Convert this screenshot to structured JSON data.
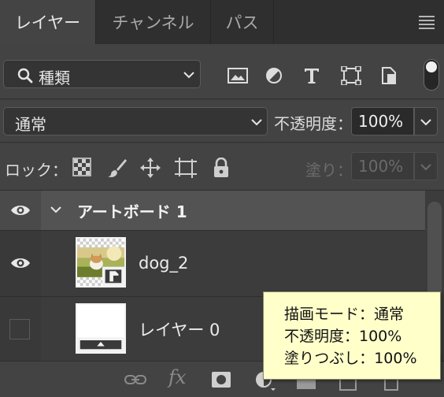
{
  "tabs": [
    {
      "label": "レイヤー",
      "active": true
    },
    {
      "label": "チャンネル",
      "active": false
    },
    {
      "label": "パス",
      "active": false
    }
  ],
  "filter": {
    "kind_label": "種類",
    "icons": [
      "image-filter-icon",
      "adjustment-filter-icon",
      "type-filter-icon",
      "shape-filter-icon",
      "smart-object-filter-icon"
    ]
  },
  "blend": {
    "mode": "通常",
    "opacity_label": "不透明度：",
    "opacity_value": "100%"
  },
  "lock": {
    "label": "ロック：",
    "fill_label": "塗り：",
    "fill_value": "100%"
  },
  "layers": [
    {
      "name": "アートボード 1",
      "type": "artboard",
      "visible": true,
      "expanded": true
    },
    {
      "name": "dog_2",
      "type": "smart-object",
      "visible": true
    },
    {
      "name": "レイヤー 0",
      "type": "pixel",
      "visible": false
    }
  ],
  "tooltip": {
    "line1": "描画モード：通常",
    "line2": "不透明度：100%",
    "line3": "塗りつぶし：100%"
  },
  "colors": {
    "panel_bg": "#434343",
    "tab_bar": "#2f2f2f",
    "tooltip_bg": "#ffffca",
    "group_row": "#535353"
  }
}
